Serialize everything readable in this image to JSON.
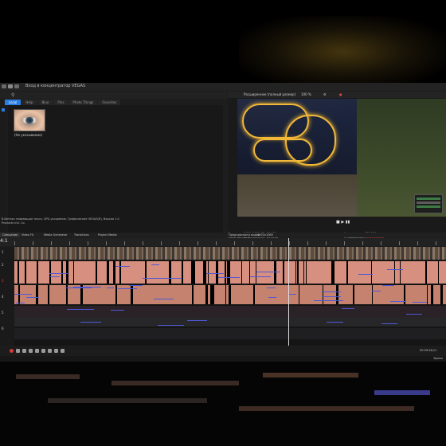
{
  "window": {
    "title": "Вход в концентратор VEGAS"
  },
  "explorer": {
    "search_icon": "search-icon",
    "tabs": [
      "Local",
      "Help",
      "Blue",
      "Pins",
      "Photo Things",
      "Favorites"
    ],
    "active_tab": 0,
    "media_item": {
      "caption": "(Не указываемо)"
    }
  },
  "preview": {
    "toolbar": {
      "mode": "Расширенное (полный размер)",
      "zoom": "100 %"
    },
    "project_label": "Проект:",
    "project_value": "1920x1080x32, 60,000p",
    "preview_label": "Предпросмотр:",
    "preview_value": "1920x1080x32, 60,000p",
    "frame_label": "Кадр:",
    "frame_value": "132 221",
    "display_label": "Отображение:",
    "display_value": "1080x608x32",
    "transport": "■ ▶ ▮▮"
  },
  "status": {
    "line1": "8-битная плавающая точка, GPU-ускорение, Графические VEGAS(R), Версия 1.0",
    "line2": "Products Intl. Co.",
    "line3": "Предпросмотр видео",
    "line3_value": "1920x1080"
  },
  "dock_tabs": [
    "Смешение",
    "Video FX",
    "Media Generator",
    "Transitions",
    "Project Media"
  ],
  "timeline": {
    "time": "4:1",
    "tracks": [
      "1",
      "2",
      "3",
      "4",
      "5",
      "6"
    ],
    "end_timecode": "00:39:26;11",
    "status_right": "Время"
  }
}
